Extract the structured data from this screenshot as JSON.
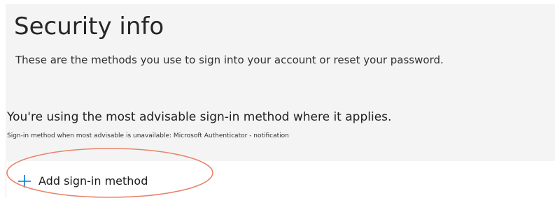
{
  "header": {
    "title": "Security info",
    "description": "These are the methods you use to sign into your account or reset your password."
  },
  "status": {
    "message": "You're using the most advisable sign-in method where it applies.",
    "fallback_note": "Sign-in method when most advisable is unavailable: Microsoft Authenticator - notification"
  },
  "actions": {
    "add_method_label": "Add sign-in method",
    "add_method_icon": "plus-icon"
  },
  "colors": {
    "accent": "#0078d4",
    "annotation": "#e8826b",
    "panel_background": "#f4f4f4"
  }
}
